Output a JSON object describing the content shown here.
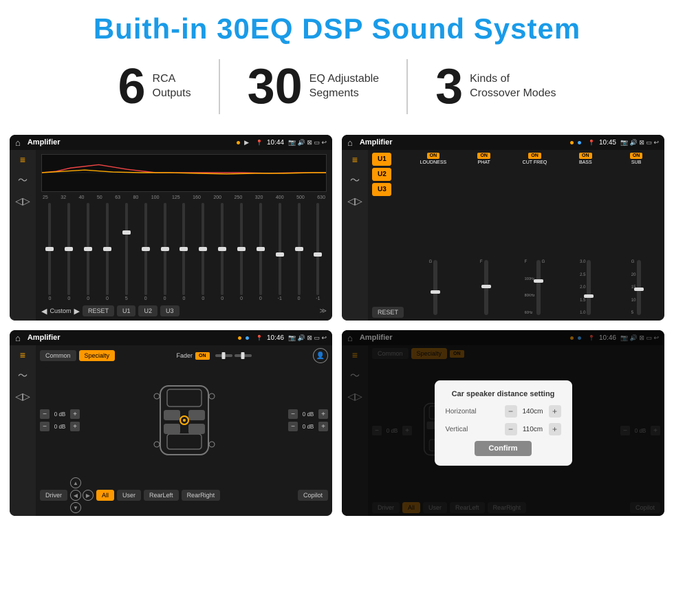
{
  "header": {
    "title": "Buith-in 30EQ DSP Sound System"
  },
  "stats": [
    {
      "number": "6",
      "label_line1": "RCA",
      "label_line2": "Outputs"
    },
    {
      "number": "30",
      "label_line1": "EQ Adjustable",
      "label_line2": "Segments"
    },
    {
      "number": "3",
      "label_line1": "Kinds of",
      "label_line2": "Crossover Modes"
    }
  ],
  "screens": [
    {
      "id": "screen1",
      "status_bar": {
        "title": "Amplifier",
        "time": "10:44",
        "icons": "📷 🔊 ⊠ ▭ ↩"
      }
    },
    {
      "id": "screen2",
      "status_bar": {
        "title": "Amplifier",
        "time": "10:45"
      }
    },
    {
      "id": "screen3",
      "status_bar": {
        "title": "Amplifier",
        "time": "10:46"
      }
    },
    {
      "id": "screen4",
      "status_bar": {
        "title": "Amplifier",
        "time": "10:46"
      }
    }
  ],
  "eq_screen": {
    "frequencies": [
      "25",
      "32",
      "40",
      "50",
      "63",
      "80",
      "100",
      "125",
      "160",
      "200",
      "250",
      "320",
      "400",
      "500",
      "630"
    ],
    "values": [
      "0",
      "0",
      "0",
      "0",
      "5",
      "0",
      "0",
      "0",
      "0",
      "0",
      "0",
      "0",
      "-1",
      "0",
      "-1"
    ],
    "preset": "Custom",
    "buttons": [
      "RESET",
      "U1",
      "U2",
      "U3"
    ]
  },
  "amp2_screen": {
    "presets": [
      "U1",
      "U2",
      "U3"
    ],
    "controls": [
      {
        "name": "LOUDNESS",
        "state": "ON"
      },
      {
        "name": "PHAT",
        "state": "ON"
      },
      {
        "name": "CUT FREQ",
        "state": "ON"
      },
      {
        "name": "BASS",
        "state": "ON"
      },
      {
        "name": "SUB",
        "state": "ON"
      }
    ],
    "reset_label": "RESET"
  },
  "fader_screen": {
    "tabs": [
      "Common",
      "Specialty"
    ],
    "active_tab": "Specialty",
    "fader_label": "Fader",
    "on_label": "ON",
    "volumes": [
      {
        "val": "0 dB"
      },
      {
        "val": "0 dB"
      },
      {
        "val": "0 dB"
      },
      {
        "val": "0 dB"
      }
    ],
    "bottom_buttons": [
      "Driver",
      "RearLeft",
      "All",
      "User",
      "RearRight",
      "Copilot"
    ]
  },
  "dialog_screen": {
    "title": "Car speaker distance setting",
    "horizontal_label": "Horizontal",
    "horizontal_value": "140cm",
    "vertical_label": "Vertical",
    "vertical_value": "110cm",
    "confirm_label": "Confirm"
  }
}
